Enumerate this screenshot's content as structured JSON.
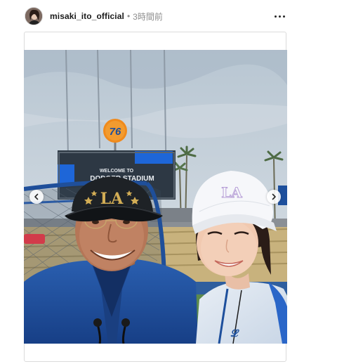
{
  "post": {
    "username": "misaki_ito_official",
    "separator": "•",
    "timestamp": "3時間前"
  },
  "icons": {
    "more": "more-horizontal-icon",
    "prev": "chevron-left-icon",
    "next": "chevron-right-icon"
  },
  "photo": {
    "scoreboard_text_line1": "WELCOME TO",
    "scoreboard_text_line2": "DODGER STADIUM",
    "sign_text": "76",
    "cap_left_text": "LA",
    "cap_right_text": "LA"
  },
  "colors": {
    "dodger_blue": "#1d4f9c",
    "sky": "#c9d3dc",
    "sign_orange": "#f08a1c"
  }
}
